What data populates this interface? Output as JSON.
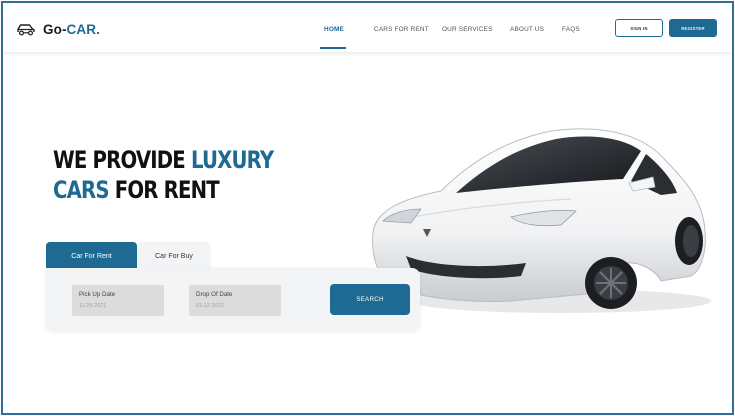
{
  "brand": {
    "name_part1": "Go-",
    "name_part2": "CAR."
  },
  "nav": {
    "home": "HOME",
    "cars_for_rent": "CARS FOR RENT",
    "our_services": "OUR SERVICES",
    "about_us": "ABOUT US",
    "faqs": "FAQS"
  },
  "auth": {
    "sign_in": "SIGN IN",
    "register": "REGISTER"
  },
  "hero": {
    "line1_dark": "WE PROVIDE ",
    "line1_blue": "LUXURY",
    "line2_blue": "CARS",
    "line2_dark": " FOR RENT"
  },
  "booking": {
    "tabs": [
      "Car For Rent",
      "Car For Buy"
    ],
    "pickup_label": "Pick Up Date",
    "pickup_value": "11-29-2021",
    "dropoff_label": "Drop Of Date",
    "dropoff_value": "01-12-2022",
    "search_label": "SEARCH"
  },
  "colors": {
    "accent": "#1e6a93",
    "field_bg": "#dcdcdc",
    "panel_bg": "#f3f4f6"
  }
}
